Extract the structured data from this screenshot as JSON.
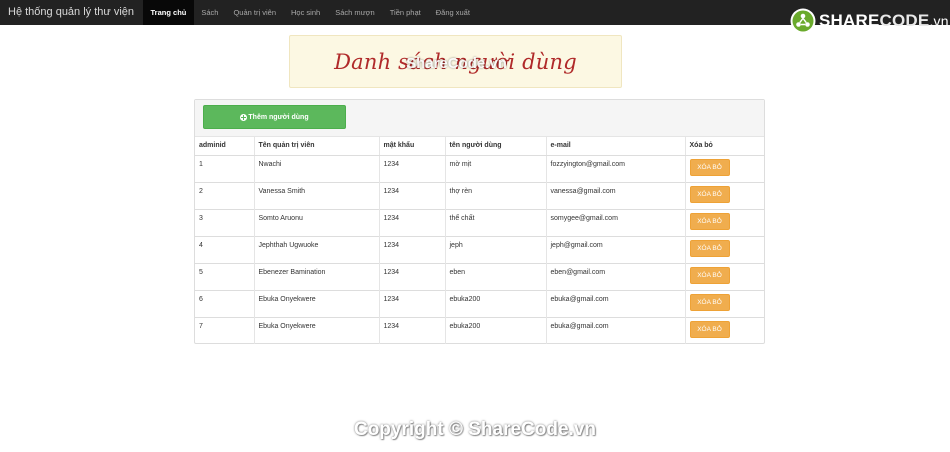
{
  "navbar": {
    "brand": "Hệ thống quản lý thư viện",
    "items": [
      {
        "label": "Trang chủ",
        "active": true
      },
      {
        "label": "Sách",
        "active": false
      },
      {
        "label": "Quản trị viên",
        "active": false
      },
      {
        "label": "Học sinh",
        "active": false
      },
      {
        "label": "Sách mượn",
        "active": false
      },
      {
        "label": "Tiền phạt",
        "active": false
      },
      {
        "label": "Đăng xuất",
        "active": false
      }
    ]
  },
  "logo": {
    "share": "SHARE",
    "code": "CODE",
    "tld": ".vn"
  },
  "banner": {
    "title": "Danh sách người dùng",
    "watermark": "ShareCode.vn"
  },
  "panel": {
    "add_button_label": "Thêm người dùng"
  },
  "table": {
    "headers": [
      "adminid",
      "Tên quản trị viên",
      "mật khẩu",
      "tên người dùng",
      "e-mail",
      "Xóa bỏ"
    ],
    "delete_label": "XÓA BỎ",
    "rows": [
      {
        "adminid": "1",
        "name": "Nwachi",
        "password": "1234",
        "username": "mờ mịt",
        "email": "fozzyington@gmail.com"
      },
      {
        "adminid": "2",
        "name": "Vanessa Smith",
        "password": "1234",
        "username": "thợ rèn",
        "email": "vanessa@gmail.com"
      },
      {
        "adminid": "3",
        "name": "Somto Aruonu",
        "password": "1234",
        "username": "thể chất",
        "email": "somygee@gmail.com"
      },
      {
        "adminid": "4",
        "name": "Jephthah Ugwuoke",
        "password": "1234",
        "username": "jeph",
        "email": "jeph@gmail.com"
      },
      {
        "adminid": "5",
        "name": "Ebenezer Bamination",
        "password": "1234",
        "username": "eben",
        "email": "eben@gmail.com"
      },
      {
        "adminid": "6",
        "name": "Ebuka Onyekwere",
        "password": "1234",
        "username": "ebuka200",
        "email": "ebuka@gmail.com"
      },
      {
        "adminid": "7",
        "name": "Ebuka Onyekwere",
        "password": "1234",
        "username": "ebuka200",
        "email": "ebuka@gmail.com"
      }
    ]
  },
  "footer": {
    "copyright": "Copyright © ShareCode.vn"
  },
  "colors": {
    "navbar": "#222222",
    "add_button": "#5cb85c",
    "delete_button": "#f0ad4e",
    "banner_bg": "#fcf8e3",
    "banner_text": "#b02a2a"
  }
}
